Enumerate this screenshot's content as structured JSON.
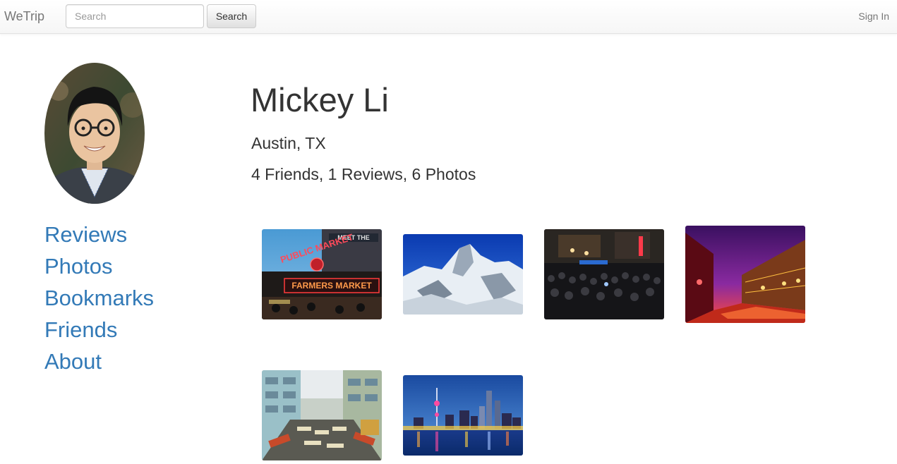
{
  "navbar": {
    "brand": "WeTrip",
    "search_placeholder": "Search",
    "search_button": "Search",
    "sign_in": "Sign In"
  },
  "profile": {
    "name": "Mickey Li",
    "location": "Austin, TX",
    "stats": "4 Friends, 1 Reviews, 6 Photos"
  },
  "sidebar": {
    "items": [
      {
        "label": "Reviews"
      },
      {
        "label": "Photos"
      },
      {
        "label": "Bookmarks"
      },
      {
        "label": "Friends"
      },
      {
        "label": "About"
      }
    ]
  },
  "photos": [
    {
      "subject": "public-market-sign",
      "sign_top": "PUBLIC MARKET",
      "sign_bottom": "FARMERS MARKET",
      "sign_corner": "MEET THE"
    },
    {
      "subject": "snowy-mountain"
    },
    {
      "subject": "night-crowd-street"
    },
    {
      "subject": "bourbon-street-night"
    },
    {
      "subject": "street-market-alley"
    },
    {
      "subject": "city-skyline-night"
    }
  ],
  "colors": {
    "link": "#337ab7",
    "text": "#333333",
    "navbar_text": "#777777"
  }
}
